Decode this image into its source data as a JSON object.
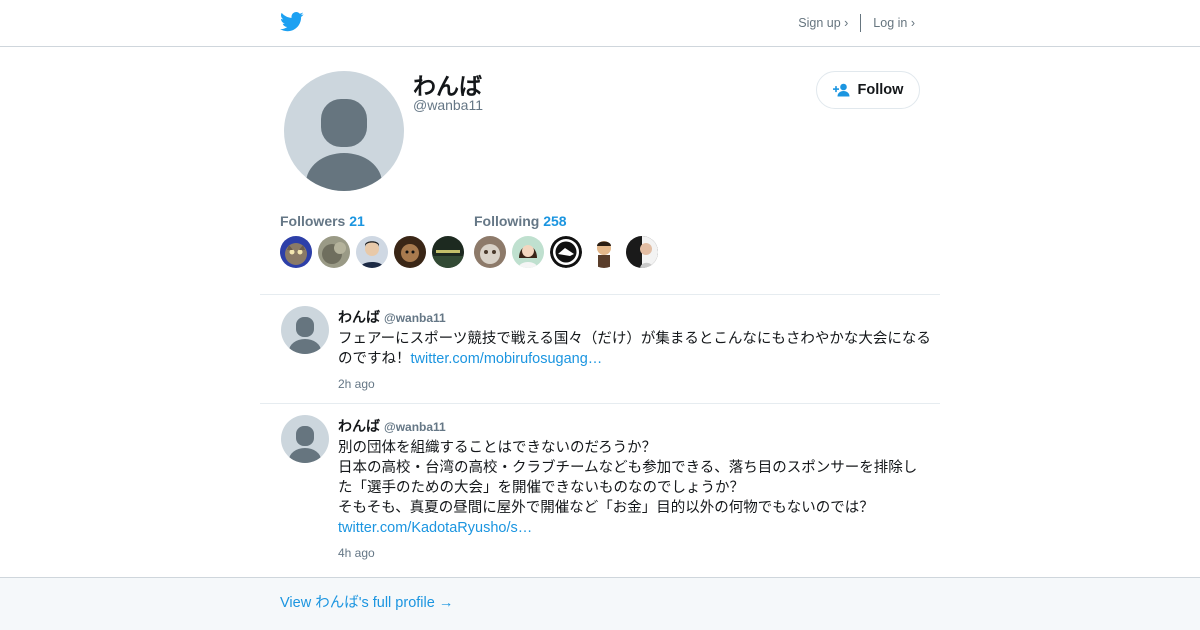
{
  "header": {
    "logo": "twitter-bird-icon",
    "signup": "Sign up ›",
    "login": "Log in ›"
  },
  "profile": {
    "name": "わんば",
    "handle": "@wanba11",
    "follow_label": "Follow",
    "followers_label": "Followers",
    "followers_count": "21",
    "following_label": "Following",
    "following_count": "258"
  },
  "tweets": [
    {
      "name": "わんば",
      "handle": "@wanba11",
      "text": "フェアーにスポーツ競技で戦える国々（だけ）が集まるとこんなにもさわやかな大会になるのですね！",
      "link": "twitter.com/mobirufosugang…",
      "time": "2h ago"
    },
    {
      "name": "わんば",
      "handle": "@wanba11",
      "text": "別の団体を組織することはできないのだろうか？\n日本の高校・台湾の高校・クラブチームなども参加できる、落ち目のスポンサーを排除した「選手のための大会」を開催できないものなのでしょうか？\nそもそも、真夏の昼間に屋外で開催など「お金」目的以外の何物でもないのでは？",
      "link": "twitter.com/KadotaRyusho/s…",
      "time": "4h ago"
    }
  ],
  "footer": {
    "link": "View わんば's full profile →"
  },
  "colors": {
    "accent": "#1b95e0",
    "brand": "#1da1f2",
    "muted": "#657786",
    "avatar_bg": "#ccd6dd",
    "avatar_fg": "#66757f"
  }
}
